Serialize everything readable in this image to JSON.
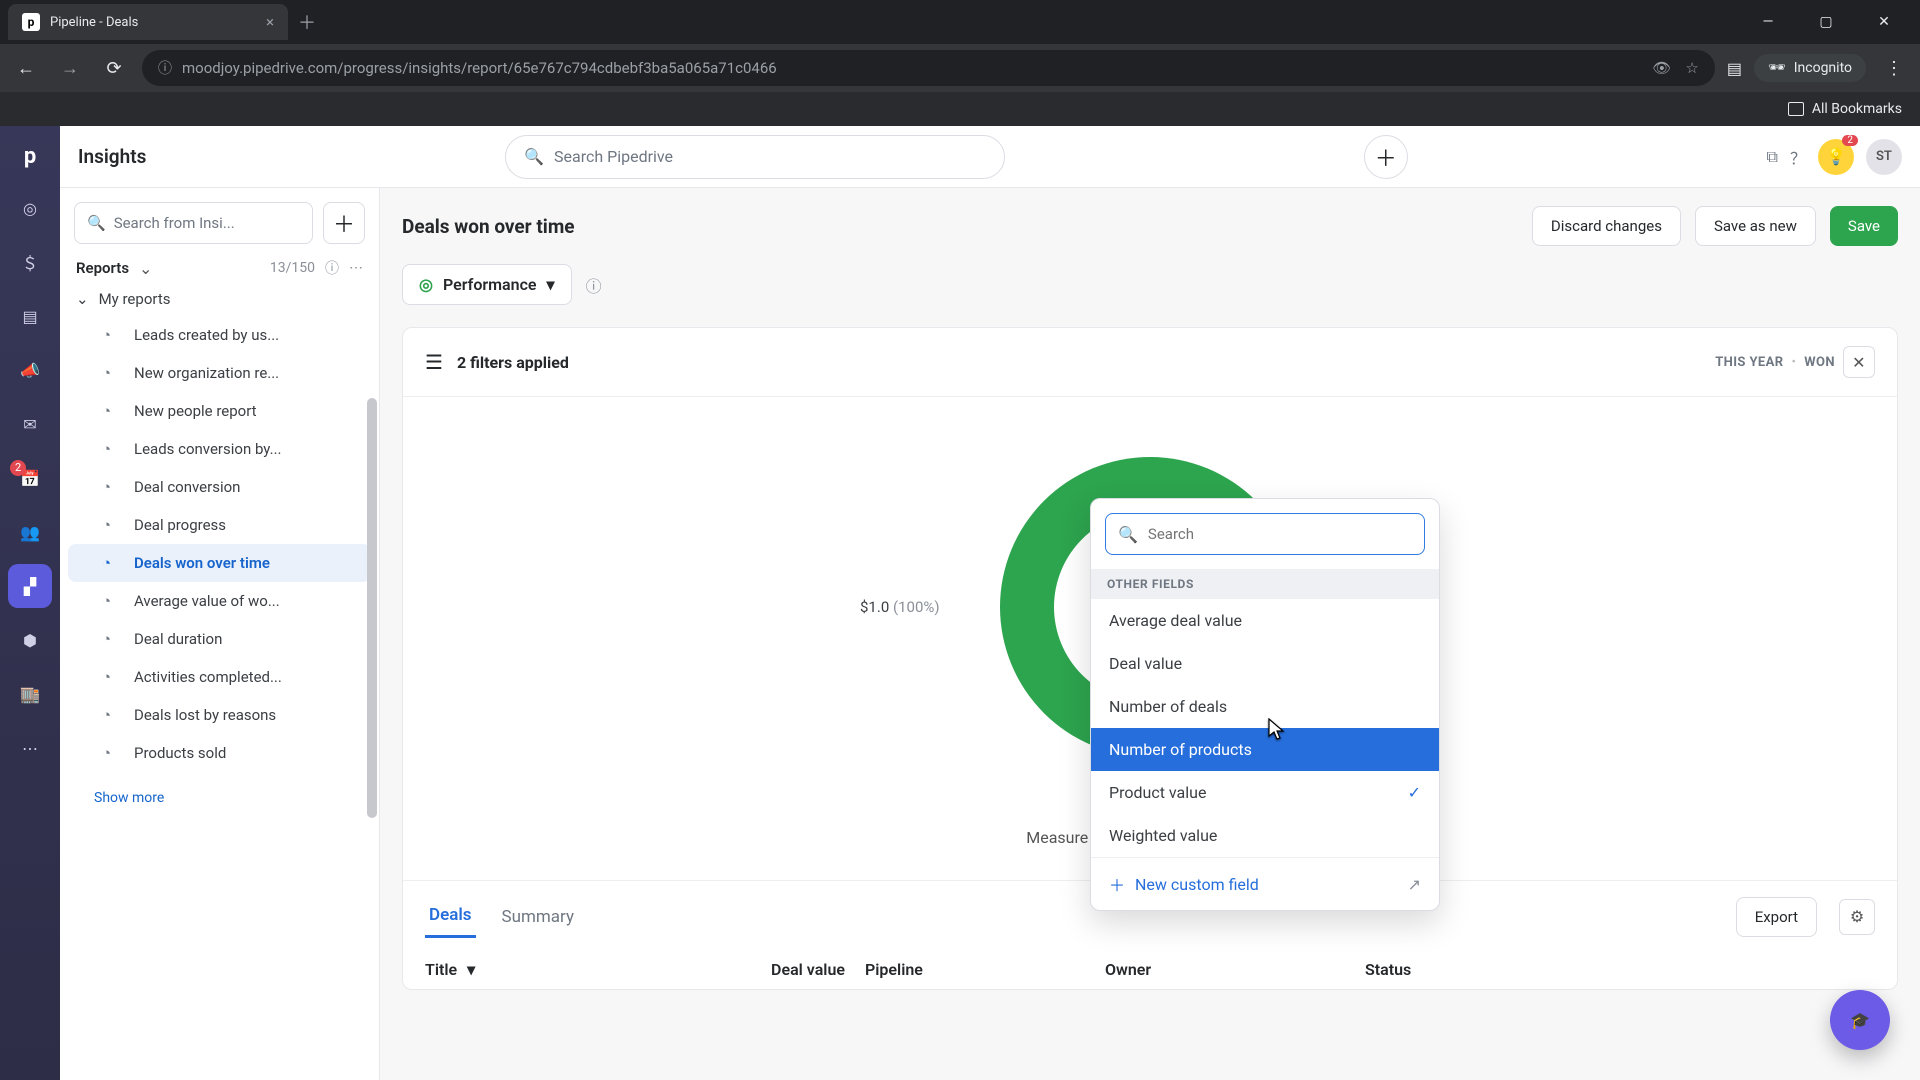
{
  "browser": {
    "tab_title": "Pipeline - Deals",
    "url": "moodjoy.pipedrive.com/progress/insights/report/65e767c794cdbebf3ba5a065a71c0466",
    "incognito_label": "Incognito",
    "all_bookmarks": "All Bookmarks"
  },
  "topbar": {
    "section": "Insights",
    "search_placeholder": "Search Pipedrive",
    "avatar": "ST",
    "idea_badge": "2"
  },
  "sidebar": {
    "search_placeholder": "Search from Insi...",
    "reports_label": "Reports",
    "reports_count": "13/150",
    "group_label": "My reports",
    "items": [
      "Leads created by us...",
      "New organization re...",
      "New people report",
      "Leads conversion by...",
      "Deal conversion",
      "Deal progress",
      "Deals won over time",
      "Average value of wo...",
      "Deal duration",
      "Activities completed...",
      "Deals lost by reasons",
      "Products sold"
    ],
    "active_index": 6,
    "show_more": "Show more"
  },
  "rail": {
    "badge_value": "2"
  },
  "canvas": {
    "title": "Deals won over time",
    "discard": "Discard changes",
    "save_as": "Save as new",
    "save": "Save",
    "perf_label": "Performance",
    "filters_label": "2 filters applied",
    "filter_tags": [
      "THIS YEAR",
      "WON"
    ],
    "chart": {
      "value": "$1.0",
      "pct": "(100%)"
    },
    "measure_label": "Measure by",
    "measure_value": "Product value",
    "tabs": [
      "Deals",
      "Summary"
    ],
    "active_tab": 0,
    "export": "Export",
    "columns": [
      "Title",
      "Deal value",
      "Pipeline",
      "Owner",
      "Status"
    ]
  },
  "popover": {
    "search_placeholder": "Search",
    "section_head": "OTHER FIELDS",
    "options": [
      "Average deal value",
      "Deal value",
      "Number of deals",
      "Number of products",
      "Product value",
      "Weighted value"
    ],
    "hover_index": 3,
    "checked_index": 4,
    "footer": "New custom field"
  },
  "chart_data": {
    "type": "pie",
    "title": "Deals won over time — Product value",
    "series": [
      {
        "name": "Won",
        "value": 1.0,
        "unit": "$",
        "percent": 100
      }
    ]
  }
}
